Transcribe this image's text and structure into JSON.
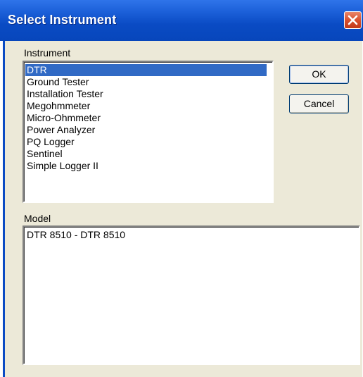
{
  "window": {
    "title": "Select Instrument"
  },
  "instrument": {
    "label": "Instrument",
    "items": [
      "DTR",
      "Ground Tester",
      "Installation Tester",
      "Megohmmeter",
      "Micro-Ohmmeter",
      "Power Analyzer",
      "PQ Logger",
      "Sentinel",
      "Simple Logger II"
    ],
    "selected": "DTR"
  },
  "buttons": {
    "ok_label": "OK",
    "cancel_label": "Cancel"
  },
  "model": {
    "label": "Model",
    "items": [
      "DTR 8510 - DTR 8510"
    ]
  },
  "colors": {
    "titlebar": "#0a4bc4",
    "selection": "#316ac5",
    "dialog_bg": "#ece9d8",
    "close_button": "#d9502e"
  },
  "icons": {
    "close": "close-icon"
  }
}
